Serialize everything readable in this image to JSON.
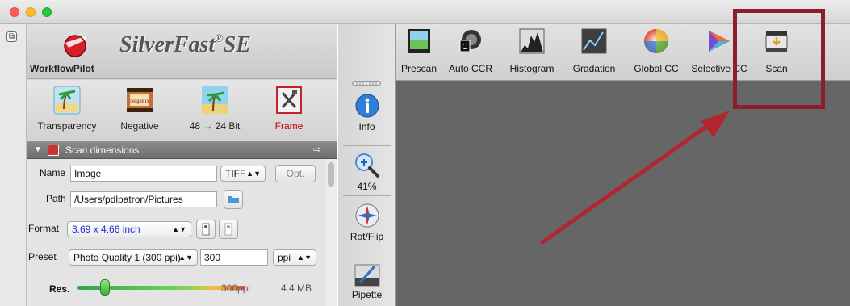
{
  "window": {
    "traffic_lights": [
      "close",
      "minimize",
      "zoom"
    ]
  },
  "header": {
    "workflow_label": "WorkflowPilot",
    "brand_name": "SilverFast",
    "brand_suffix": "SE",
    "brand_mark": "®"
  },
  "modes": [
    {
      "label": "Transparency",
      "icon": "transparency-icon",
      "active": false
    },
    {
      "label": "Negative",
      "icon": "negafix-icon",
      "active": false
    },
    {
      "label": "48 → 24 Bit",
      "icon": "bitdepth-icon",
      "active": false
    },
    {
      "label": "Frame",
      "icon": "frame-tools-icon",
      "active": true
    }
  ],
  "section": {
    "title": "Scan dimensions",
    "collapse_glyph": "▼"
  },
  "form": {
    "name_label": "Name",
    "name_value": "Image",
    "filetype_value": "TIFF",
    "opt_label": "Opt.",
    "path_label": "Path",
    "path_value": "/Users/pdlpatron/Pictures",
    "format_label": "Format",
    "format_value": "3.69 x 4.66 inch",
    "preset_label": "Preset",
    "preset_value": "Photo Quality 1 (300 ppi)",
    "preset_ppi_value": "300",
    "unit_value": "ppi",
    "res_label": "Res.",
    "res_value": "300ppi",
    "file_size": "4.4 MB"
  },
  "tools": [
    {
      "label": "Info",
      "icon": "info-icon"
    },
    {
      "label": "41%",
      "icon": "zoom-icon"
    },
    {
      "label": "Rot/Flip",
      "icon": "compass-icon"
    },
    {
      "label": "Pipette",
      "icon": "pipette-icon"
    }
  ],
  "toolbar": [
    {
      "label": "Prescan",
      "icon": "prescan-icon"
    },
    {
      "label": "Auto CCR",
      "icon": "auto-ccr-icon"
    },
    {
      "label": "Histogram",
      "icon": "histogram-icon"
    },
    {
      "label": "Gradation",
      "icon": "gradation-icon"
    },
    {
      "label": "Global CC",
      "icon": "global-cc-icon"
    },
    {
      "label": "Selective CC",
      "icon": "selective-cc-icon"
    },
    {
      "label": "Scan",
      "icon": "scan-icon"
    }
  ],
  "colors": {
    "highlight_box": "#8e1d2a",
    "arrow": "#b1262f",
    "canvas": "#666666",
    "active_mode": "#c00000"
  }
}
